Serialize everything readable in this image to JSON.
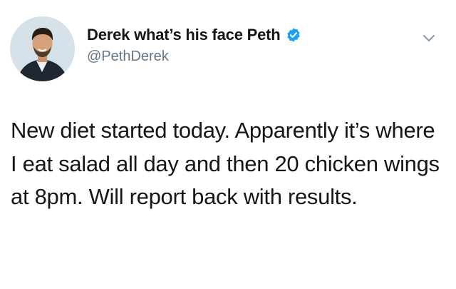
{
  "tweet": {
    "author": {
      "display_name": "Derek what’s his face Peth",
      "handle": "@PethDerek",
      "verified": true,
      "avatar_icon": "profile-photo"
    },
    "text": "New diet started today. Apparently it’s where I eat salad all day and then 20 chicken wings at 8pm. Will report back with results.",
    "menu_icon": "chevron-down-icon"
  },
  "colors": {
    "verified_badge": "#1da1f2",
    "handle_text": "#657786",
    "body_text": "#14171a",
    "chevron": "#8899a6"
  }
}
